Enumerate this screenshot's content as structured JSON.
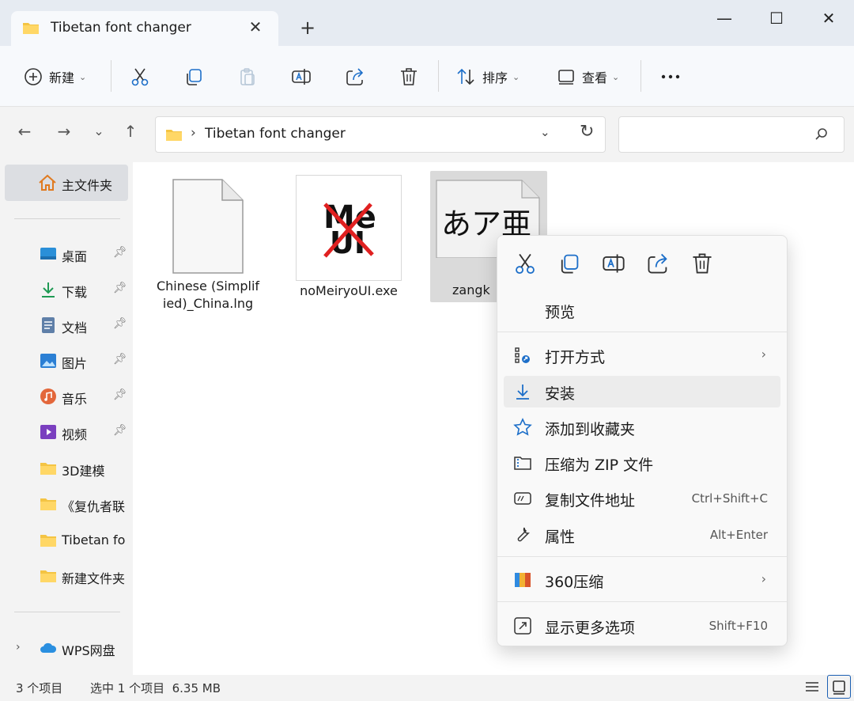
{
  "window": {
    "tab_title": "Tibetan font changer",
    "tab_close": "✕",
    "new_tab": "+",
    "minimize": "—",
    "maximize": "☐",
    "close": "✕"
  },
  "toolbar": {
    "new_label": "新建",
    "sort_label": "排序",
    "view_label": "查看",
    "more_label": "···",
    "icons": [
      "plus-circle-icon",
      "cut-icon",
      "copy-icon",
      "paste-icon",
      "rename-icon",
      "share-icon",
      "delete-icon",
      "sort-icon",
      "view-icon",
      "more-icon"
    ]
  },
  "address": {
    "path": "Tibetan font changer",
    "separator": "›",
    "search_placeholder": ""
  },
  "sidebar": {
    "home": "主文件夹",
    "quick_access": [
      {
        "label": "桌面",
        "icon": "desktop-icon",
        "pinned": true
      },
      {
        "label": "下载",
        "icon": "download-icon",
        "pinned": true
      },
      {
        "label": "文档",
        "icon": "document-icon",
        "pinned": true
      },
      {
        "label": "图片",
        "icon": "pictures-icon",
        "pinned": true
      },
      {
        "label": "音乐",
        "icon": "music-icon",
        "pinned": true
      },
      {
        "label": "视频",
        "icon": "video-icon",
        "pinned": true
      }
    ],
    "folders": [
      {
        "label": "3D建模",
        "icon": "folder-icon"
      },
      {
        "label": "《复仇者联",
        "icon": "folder-icon"
      },
      {
        "label": "Tibetan fo",
        "icon": "folder-icon"
      },
      {
        "label": "新建文件夹",
        "icon": "folder-icon"
      }
    ],
    "cloud": {
      "label": "WPS网盘",
      "icon": "cloud-icon"
    }
  },
  "files": [
    {
      "name": "Chinese (Simplified)_China.lng",
      "icon": "blank-file-icon",
      "selected": false
    },
    {
      "name": "noMeiryoUI.exe",
      "icon": "app-icon",
      "selected": false
    },
    {
      "name": "zangk",
      "icon": "font-file-icon",
      "preview": "あア亜",
      "selected": true
    }
  ],
  "context_menu": {
    "top_icons": [
      "cut-icon",
      "copy-icon",
      "rename-icon",
      "share-icon",
      "delete-icon"
    ],
    "items": [
      {
        "label": "预览",
        "icon": "",
        "shortcut": "",
        "submenu": false
      },
      {
        "label": "打开方式",
        "icon": "open-with-icon",
        "shortcut": "",
        "submenu": true
      },
      {
        "label": "安装",
        "icon": "install-icon",
        "shortcut": "",
        "submenu": false,
        "highlighted": true
      },
      {
        "label": "添加到收藏夹",
        "icon": "star-icon",
        "shortcut": "",
        "submenu": false
      },
      {
        "label": "压缩为 ZIP 文件",
        "icon": "zip-icon",
        "shortcut": "",
        "submenu": false
      },
      {
        "label": "复制文件地址",
        "icon": "copy-path-icon",
        "shortcut": "Ctrl+Shift+C",
        "submenu": false
      },
      {
        "label": "属性",
        "icon": "wrench-icon",
        "shortcut": "Alt+Enter",
        "submenu": false
      },
      {
        "label": "360压缩",
        "icon": "360-zip-icon",
        "shortcut": "",
        "submenu": true
      },
      {
        "label": "显示更多选项",
        "icon": "more-options-icon",
        "shortcut": "Shift+F10",
        "submenu": false
      }
    ],
    "submenu_arrow": "›"
  },
  "status": {
    "item_count": "3 个项目",
    "selection": "选中 1 个项目  6.35 MB"
  },
  "colors": {
    "accent": "#1b5fb3",
    "icon_blue": "#1d6fc9",
    "folder_yellow": "#f4c443",
    "selection_gray": "#dadada",
    "exe_red": "#e02020"
  }
}
